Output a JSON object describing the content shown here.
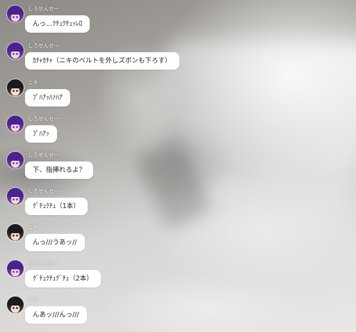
{
  "messages": [
    {
      "sender": "しろせんせー",
      "avatar": "purple",
      "text": "んっ…ｸﾁｭｸﾁｭｯﾚﾛ"
    },
    {
      "sender": "しろせんせー",
      "avatar": "purple",
      "text": "ｶﾁｬｶﾁｬ（ニキのベルトを外しズボンも下ろす）"
    },
    {
      "sender": "ニキ",
      "avatar": "dark",
      "text": "ﾌﾟﾊｱｯﾊｧﾊｱ"
    },
    {
      "sender": "しろせんせー",
      "avatar": "purple",
      "text": "ﾌﾟﾊｱｯ"
    },
    {
      "sender": "しろせんせー",
      "avatar": "purple",
      "text": "下、指挿れるよ？"
    },
    {
      "sender": "しろせんせー",
      "avatar": "purple",
      "text": "ｸﾞﾁｭｸﾁｭ（1本）"
    },
    {
      "sender": "ニキ",
      "avatar": "dark",
      "text": "んっ///うあッ//"
    },
    {
      "sender": "しろせんせー",
      "avatar": "purple",
      "text": "ｸﾞﾁｭｸﾁｭｸﾞﾁｭ（2本）"
    },
    {
      "sender": "ニキ",
      "avatar": "dark",
      "text": "んあッ///んっ///"
    }
  ]
}
